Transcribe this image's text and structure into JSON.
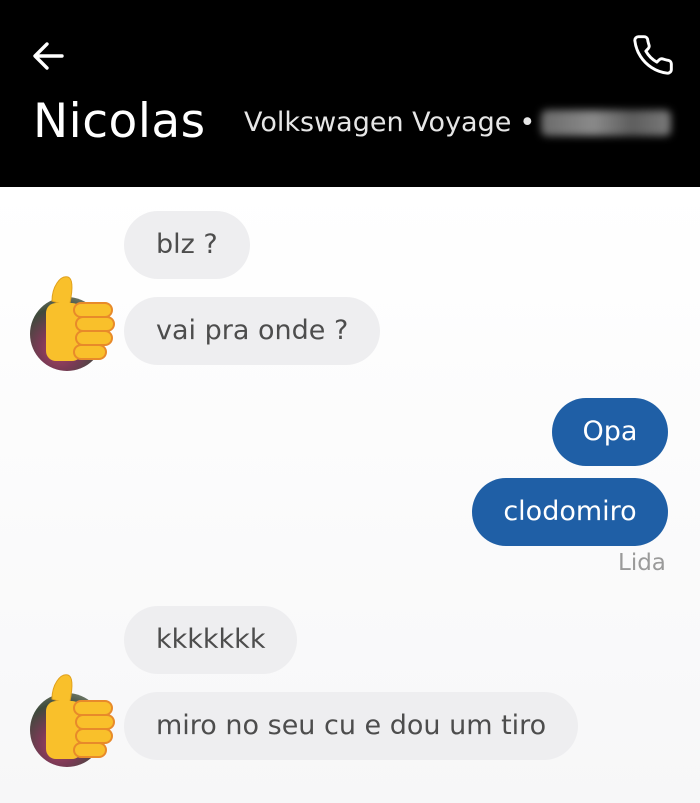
{
  "header": {
    "contact_name": "Nicolas",
    "vehicle": "Volkswagen Voyage",
    "separator": "•",
    "back_icon": "arrow-left-icon",
    "call_icon": "phone-icon"
  },
  "messages": [
    {
      "side": "incoming",
      "text": "blz ?"
    },
    {
      "side": "incoming",
      "text": "vai pra onde ?"
    },
    {
      "side": "outgoing",
      "text": "Opa"
    },
    {
      "side": "outgoing",
      "text": "clodomiro"
    },
    {
      "side": "incoming",
      "text": "kkkkkkk"
    },
    {
      "side": "incoming",
      "text": "miro no seu cu e dou um tiro"
    }
  ],
  "read_status": "Lida",
  "colors": {
    "header_bg": "#000000",
    "outgoing_bubble": "#1f5fa6",
    "incoming_bubble": "#eeeef0"
  },
  "sticker": "thumbs-up-icon"
}
